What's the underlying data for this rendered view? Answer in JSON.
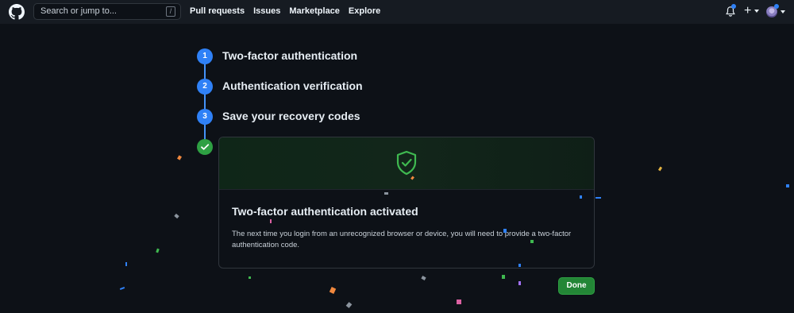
{
  "header": {
    "search_placeholder": "Search or jump to...",
    "search_shortcut": "/",
    "nav": [
      "Pull requests",
      "Issues",
      "Marketplace",
      "Explore"
    ],
    "plus_label": "+"
  },
  "steps": [
    {
      "number": "1",
      "label": "Two-factor authentication"
    },
    {
      "number": "2",
      "label": "Authentication verification"
    },
    {
      "number": "3",
      "label": "Save your recovery codes"
    }
  ],
  "card": {
    "title": "Two-factor authentication activated",
    "body": "The next time you login from an unrecognized browser or device, you will need to provide a two-factor authentication code."
  },
  "done_button": "Done",
  "colors": {
    "accent": "#2f81f7",
    "success": "#2ea043",
    "background": "#0d1117",
    "header": "#161b22"
  },
  "icons": [
    "github-logo-icon",
    "bell-icon",
    "plus-icon",
    "avatar",
    "check-icon",
    "shield-check-icon"
  ]
}
